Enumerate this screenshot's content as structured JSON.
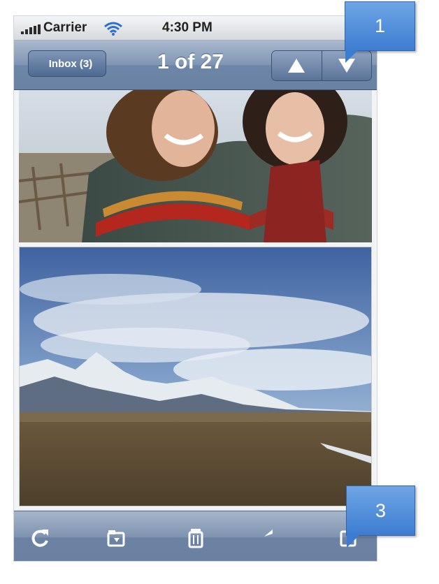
{
  "status_bar": {
    "carrier": "Carrier",
    "time": "4:30 PM"
  },
  "nav_bar": {
    "back_label": "Inbox (3)",
    "title": "1 of 27",
    "prev_icon": "up-triangle-icon",
    "next_icon": "down-triangle-icon"
  },
  "content": {
    "photo_1": "two-people-wrapped-in-blanket",
    "photo_2": "snowy-mountains-and-prairie-landscape"
  },
  "toolbar": {
    "icons": [
      "refresh-icon",
      "move-to-folder-icon",
      "trash-icon",
      "reply-icon",
      "compose-icon"
    ]
  },
  "callouts": [
    {
      "label": "1"
    },
    {
      "label": "3"
    }
  ],
  "colors": {
    "nav": "#7f95b3",
    "callout": "#4f8ad9"
  }
}
